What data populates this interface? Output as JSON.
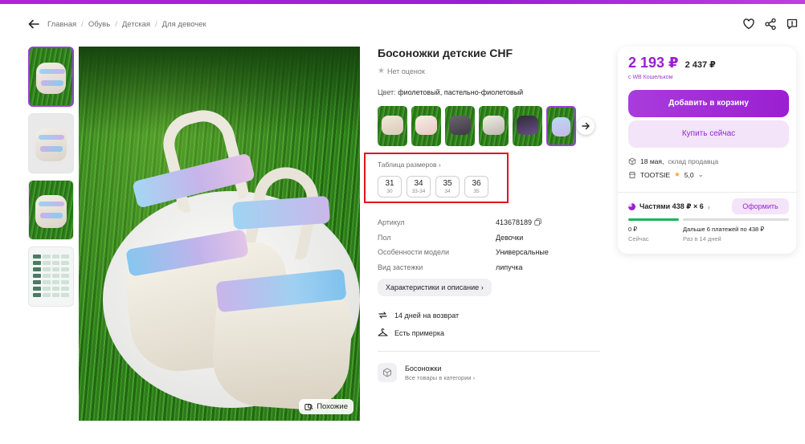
{
  "breadcrumbs": [
    "Главная",
    "Обувь",
    "Детская",
    "Для девочек"
  ],
  "header_icons": [
    "heart-icon",
    "share-icon",
    "report-icon"
  ],
  "product": {
    "title": "Босоножки детские CHF",
    "rating_text": "Нет оценок",
    "color_label": "Цвет:",
    "color_value": "фиолетовый, пастельно-фиолетовый",
    "similar_label": "Похожие"
  },
  "sizes": {
    "title": "Таблица размеров",
    "items": [
      {
        "ru": "31",
        "eu": "30"
      },
      {
        "ru": "34",
        "eu": "33-34"
      },
      {
        "ru": "35",
        "eu": "34"
      },
      {
        "ru": "36",
        "eu": "35"
      }
    ]
  },
  "specs": [
    {
      "key": "Артикул",
      "value": "413678189"
    },
    {
      "key": "Пол",
      "value": "Девочки"
    },
    {
      "key": "Особенности модели",
      "value": "Универсальные"
    },
    {
      "key": "Вид застежки",
      "value": "липучка"
    }
  ],
  "chars_button": "Характеристики и описание",
  "features": [
    "14 дней на возврат",
    "Есть примерка"
  ],
  "category": {
    "name": "Босоножки",
    "link": "Все товары в категории"
  },
  "price": {
    "current": "2 193 ₽",
    "old": "2 437 ₽",
    "wallet_note": "с WB Кошельком"
  },
  "buttons": {
    "cart": "Добавить в корзину",
    "buy": "Купить сейчас"
  },
  "delivery": {
    "date": "18 мая,",
    "source": "склад продавца"
  },
  "seller": {
    "name": "TOOTSIE",
    "rating": "5,0"
  },
  "installments": {
    "label": "Частями 438 ₽ × 6",
    "button": "Оформить",
    "now_value": "0 ₽",
    "now_label": "Сейчас",
    "later_value": "Дальше 6 платежей по 438 ₽",
    "later_label": "Раз в 14 дней"
  },
  "colors": {
    "accent": "#9a1fd1",
    "highlight_box": "#e3141c"
  }
}
